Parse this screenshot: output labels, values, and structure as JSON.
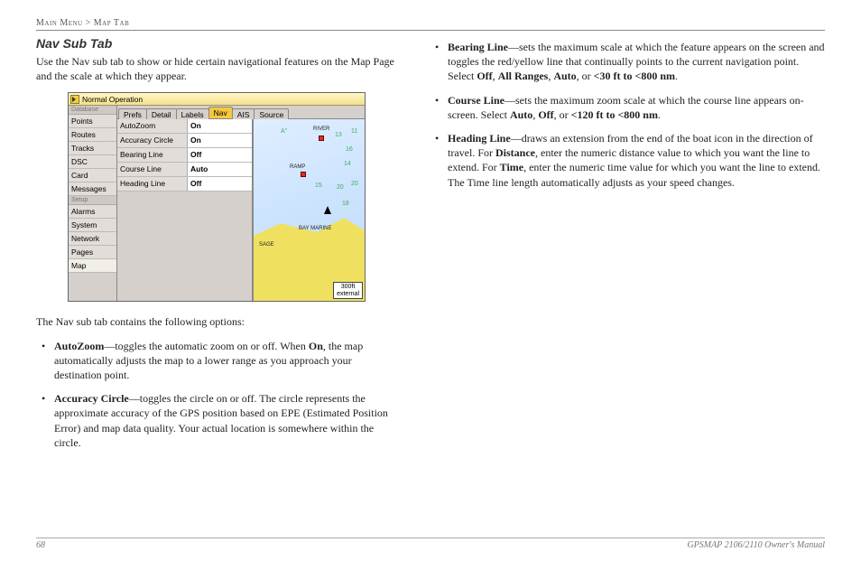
{
  "breadcrumb": {
    "left": "Main Menu",
    "sep": ">",
    "right": "Map Tab"
  },
  "section_title": "Nav Sub Tab",
  "intro": "Use the Nav sub tab to show or hide certain navigational features on the Map Page and the scale at which they appear.",
  "options_intro": "The Nav sub tab contains the following options:",
  "left_bullets": [
    {
      "term": "AutoZoom",
      "desc": "—toggles the automatic zoom on or off. When ",
      "bold_in": "On",
      "desc2": ", the map automatically adjusts the map to a lower range as you approach your destination point."
    },
    {
      "term": "Accuracy Circle",
      "desc": "—toggles the circle on or off. The circle represents the approximate accuracy of the GPS position based on EPE (Estimated Position Error) and map data quality. Your actual location is somewhere within the circle.",
      "bold_in": "",
      "desc2": ""
    }
  ],
  "right_bullets": [
    {
      "term": "Bearing Line",
      "desc": "—sets the maximum scale at which the feature appears on the screen and toggles the red/yellow line that continually points to the current navigation point. Select ",
      "opts": [
        "Off",
        "All Ranges",
        "Auto"
      ],
      "tail": ", or ",
      "range": "<30 ft to <800 nm",
      "end": "."
    },
    {
      "term": "Course Line",
      "desc": "—sets the maximum zoom scale at which the course line appears on-screen. Select ",
      "opts": [
        "Auto",
        "Off"
      ],
      "tail": ", or ",
      "range": "<120 ft to <800 nm",
      "end": "."
    },
    {
      "term": "Heading Line",
      "desc": "—draws an extension from the end of the boat icon in the direction of travel. For ",
      "k1": "Distance",
      "mid1": ", enter the numeric distance value to which you want the line to extend. For ",
      "k2": "Time",
      "mid2": ", enter the numeric time value for which you want the line to extend. The Time line length automatically adjusts as your speed changes."
    }
  ],
  "screenshot": {
    "title": "Normal Operation",
    "side_header1": "Database",
    "side_items1": [
      "Points",
      "Routes",
      "Tracks",
      "DSC",
      "Card",
      "Messages"
    ],
    "side_header2": "Setup",
    "side_items2": [
      "Alarms",
      "System",
      "Network",
      "Pages",
      "Map"
    ],
    "side_selected": "Map",
    "tabs": [
      "Prefs",
      "Detail",
      "Labels",
      "Nav",
      "AIS",
      "Source"
    ],
    "tab_selected": "Nav",
    "options": [
      {
        "label": "AutoZoom",
        "value": "On"
      },
      {
        "label": "Accuracy Circle",
        "value": "On"
      },
      {
        "label": "Bearing Line",
        "value": "Off"
      },
      {
        "label": "Course Line",
        "value": "Auto"
      },
      {
        "label": "Heading Line",
        "value": "Off"
      }
    ],
    "map_markers": {
      "river": "RIVER",
      "ramp": "RAMP",
      "sage": "SAGE",
      "marine": "BAY MARINE"
    },
    "scale": {
      "dist": "300ft",
      "src": "external"
    }
  },
  "footer": {
    "page": "68",
    "doc": "GPSMAP 2106/2110 Owner's Manual"
  }
}
